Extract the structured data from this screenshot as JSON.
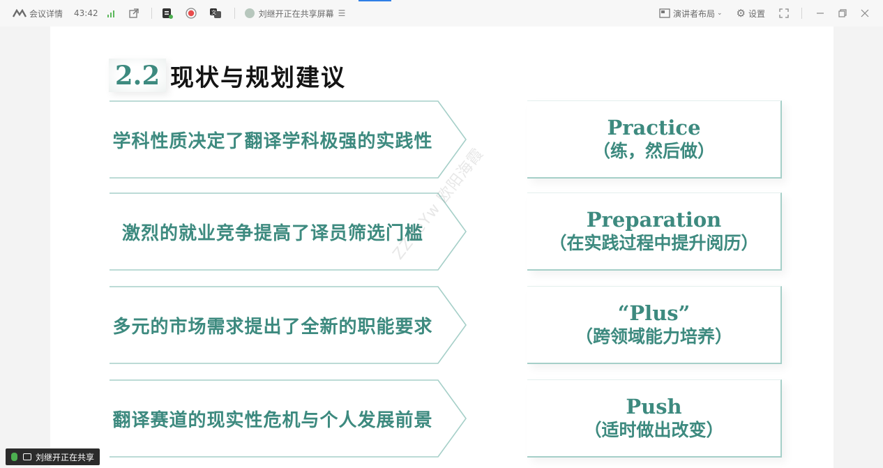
{
  "toolbar": {
    "meeting_details": "会议详情",
    "duration": "43:42",
    "sharing_status": "刘继开正在共享屏幕",
    "layout_label": "演讲者布局",
    "settings_label": "设置"
  },
  "slide": {
    "section_number": "2.2",
    "section_title": "现状与规划建议",
    "rows": [
      {
        "left": "学科性质决定了翻译学科极强的实践性",
        "en": "Practice",
        "cn": "（练，然后做）"
      },
      {
        "left": "激烈的就业竞争提高了译员筛选门槛",
        "en": "Preparation",
        "cn": "（在实践过程中提升阅历）"
      },
      {
        "left": "多元的市场需求提出了全新的职能要求",
        "en": "“Plus”",
        "cn": "（跨领域能力培养）"
      },
      {
        "left": "翻译赛道的现实性危机与个人发展前景",
        "en": "Push",
        "cn": "（适时做出改变）"
      }
    ],
    "watermark": "ZZdeYw 欧阳海霞"
  },
  "sharebar": {
    "label": "刘继开正在共享"
  },
  "colors": {
    "accent": "#3d8a7f",
    "border": "#a5cfc8",
    "toolbar_indicator": "#2f7fe6"
  }
}
